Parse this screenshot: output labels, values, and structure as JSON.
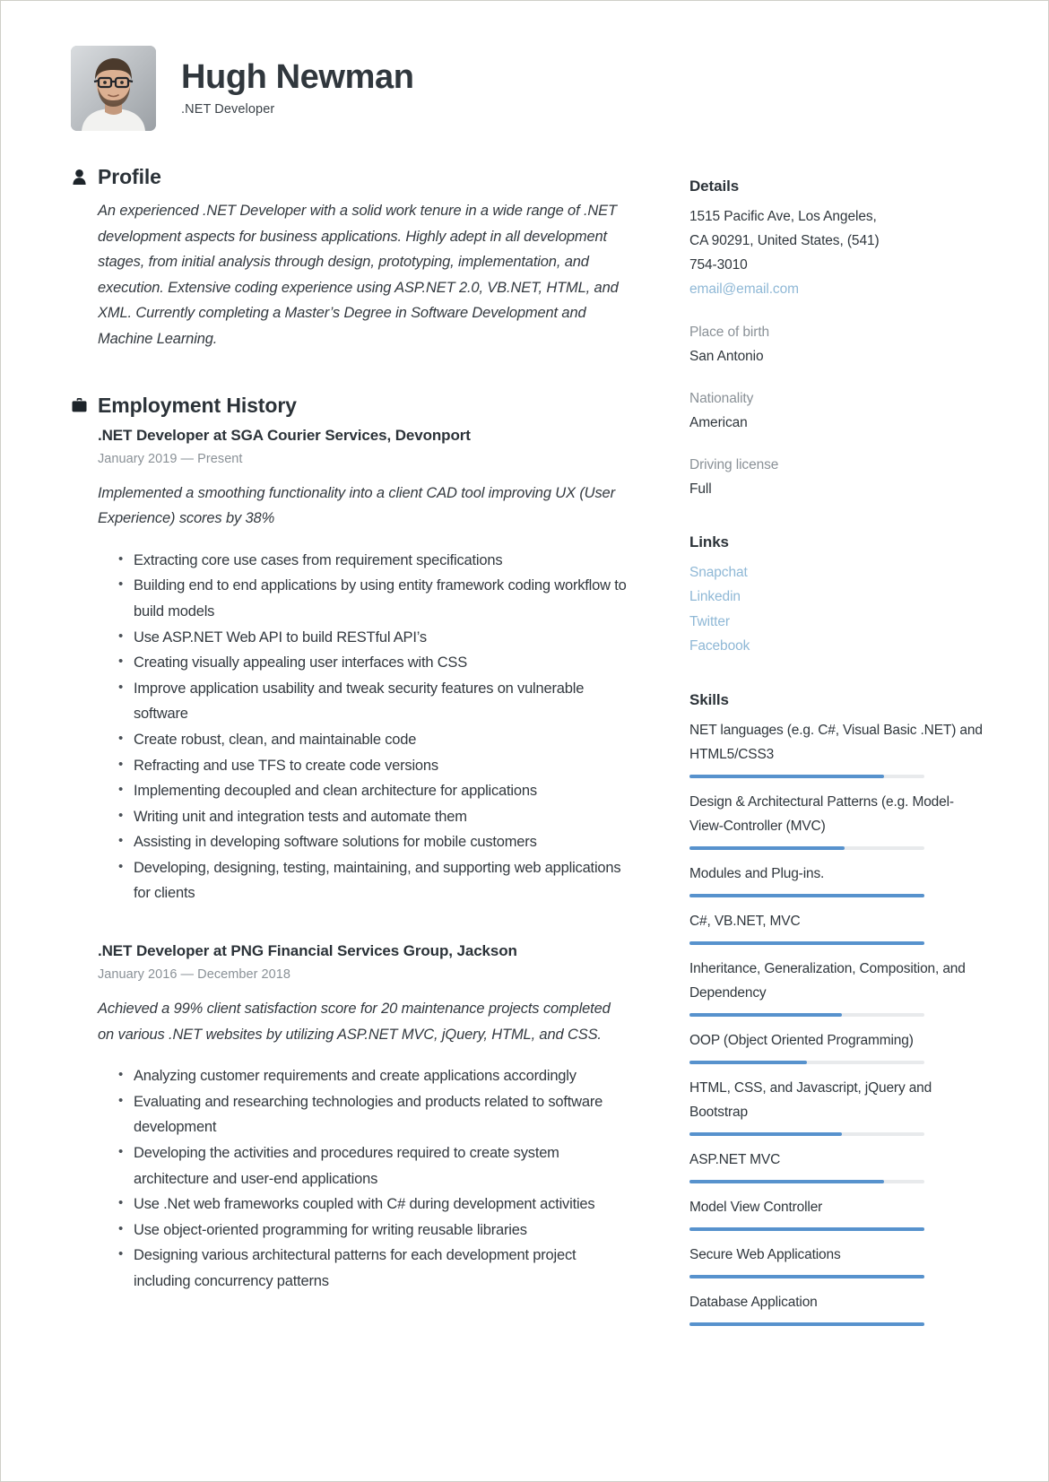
{
  "header": {
    "name": "Hugh Newman",
    "job_title": ".NET Developer",
    "avatar_alt": "portrait photo"
  },
  "profile": {
    "heading": "Profile",
    "icon": "person-icon",
    "text": "An experienced .NET Developer with a solid work tenure in a wide range of .NET development aspects for business applications. Highly adept in all development stages, from initial analysis through design, prototyping, implementation, and execution. Extensive coding experience using ASP.NET 2.0, VB.NET, HTML, and XML. Currently completing a Master’s Degree in Software Development and Machine Learning."
  },
  "employment": {
    "heading": "Employment History",
    "icon": "briefcase-icon",
    "jobs": [
      {
        "title": ".NET Developer at SGA Courier Services, Devonport",
        "dates": "January 2019 — Present",
        "summary": "Implemented a smoothing functionality into a client CAD tool improving UX (User Experience) scores by 38%",
        "bullets": [
          "Extracting core use cases from requirement specifications",
          "Building end to end applications by using entity framework coding workflow to build models",
          "Use ASP.NET Web API to build RESTful API’s",
          "Creating visually appealing user interfaces with CSS",
          "Improve application usability and tweak security features on vulnerable software",
          "Create robust, clean, and maintainable code",
          "Refracting and use TFS to create code versions",
          "Implementing decoupled and clean architecture for applications",
          "Writing unit and integration tests and automate them",
          "Assisting in developing software solutions for mobile customers",
          "Developing, designing, testing, maintaining, and supporting web applications for clients"
        ]
      },
      {
        "title": ".NET Developer at PNG Financial Services Group, Jackson",
        "dates": "January 2016 — December 2018",
        "summary": "Achieved a 99% client satisfaction score for 20 maintenance projects completed on various .NET websites by utilizing ASP.NET MVC, jQuery, HTML, and CSS.",
        "bullets": [
          "Analyzing customer requirements and create applications accordingly",
          "Evaluating and researching technologies and products related to software development",
          "Developing the activities and procedures required to create system architecture and user-end applications",
          "Use .Net web frameworks coupled with C# during development activities",
          "Use object-oriented programming for writing reusable libraries",
          "Designing various architectural patterns for each development project including concurrency patterns"
        ]
      }
    ]
  },
  "details": {
    "heading": "Details",
    "address_lines": [
      "1515 Pacific Ave, Los Angeles,",
      "CA 90291, United States, (541)",
      "754-3010"
    ],
    "email": "email@email.com",
    "fields": [
      {
        "label": "Place of birth",
        "value": "San Antonio"
      },
      {
        "label": "Nationality",
        "value": "American"
      },
      {
        "label": "Driving license",
        "value": "Full"
      }
    ]
  },
  "links": {
    "heading": "Links",
    "items": [
      "Snapchat",
      "Linkedin",
      "Twitter",
      "Facebook"
    ]
  },
  "skills": {
    "heading": "Skills",
    "items": [
      {
        "name": "NET languages (e.g. C#, Visual Basic .NET) and HTML5/CSS3",
        "level": 83
      },
      {
        "name": "Design & Architectural Patterns (e.g. Model-View-Controller (MVC)",
        "level": 66
      },
      {
        "name": "Modules and Plug-ins.",
        "level": 100
      },
      {
        "name": "C#, VB.NET, MVC",
        "level": 100
      },
      {
        "name": "Inheritance, Generalization, Composition, and Dependency",
        "level": 65
      },
      {
        "name": "OOP (Object Oriented Programming)",
        "level": 50
      },
      {
        "name": "HTML, CSS, and Javascript, jQuery and Bootstrap",
        "level": 65
      },
      {
        "name": "ASP.NET MVC",
        "level": 83
      },
      {
        "name": "Model View Controller",
        "level": 100
      },
      {
        "name": "Secure Web Applications",
        "level": 100
      },
      {
        "name": "Database Application",
        "level": 100
      }
    ]
  },
  "colors": {
    "accent": "#5792cd",
    "link": "#8fb8d6",
    "muted": "#8a9197",
    "text": "#2f363c"
  }
}
